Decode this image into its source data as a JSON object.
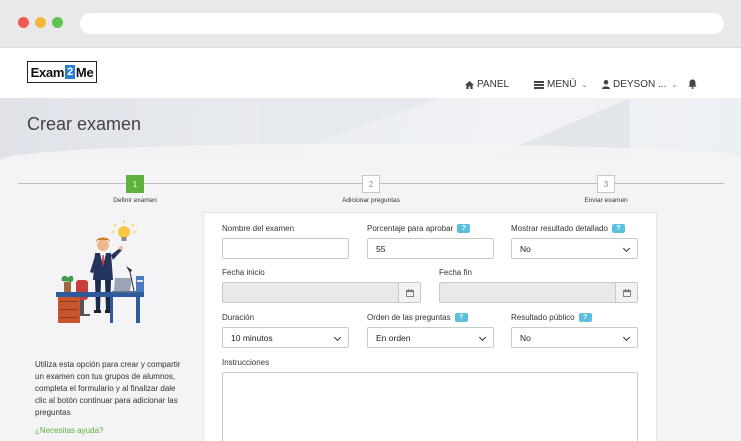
{
  "navbar": {
    "logo_left": "Exam",
    "logo_mid": "2",
    "logo_right": "Me",
    "panel": "PANEL",
    "menu": "MENÚ",
    "user": "DEYSON ..."
  },
  "page": {
    "title": "Crear examen"
  },
  "steps": [
    {
      "number": "1",
      "label": "Definir examen",
      "active": true
    },
    {
      "number": "2",
      "label": "Adicionar preguntas",
      "active": false
    },
    {
      "number": "3",
      "label": "Enviar examen",
      "active": false
    }
  ],
  "sidebar": {
    "description": "Utiliza esta opción para crear y compartir un examen con tus grupos de alumnos, completa el formulario y al finalizar dale clic al botón continuar para adicionar las preguntas",
    "help_link": "¿Necesitas ayuda?"
  },
  "form": {
    "exam_name": {
      "label": "Nombre del examen",
      "value": ""
    },
    "pass_percent": {
      "label": "Porcentaje para aprobar",
      "value": "55"
    },
    "show_result": {
      "label": "Mostrar resultado detallado",
      "value": "No"
    },
    "start_date": {
      "label": "Fecha inicio",
      "value": ""
    },
    "end_date": {
      "label": "Fecha fin",
      "value": ""
    },
    "duration": {
      "label": "Duración",
      "value": "10 minutos"
    },
    "question_order": {
      "label": "Orden de las preguntas",
      "value": "En orden"
    },
    "public_result": {
      "label": "Resultado público",
      "value": "No"
    },
    "instructions": {
      "label": "Instrucciones",
      "value": ""
    },
    "help_badge": "?"
  },
  "colors": {
    "accent_green": "#5fb13b",
    "info_badge": "#5bc0de",
    "logo_blue": "#2a7fd4"
  },
  "icons": [
    "home-icon",
    "menu-icon",
    "user-icon",
    "bell-icon",
    "calendar-icon",
    "chevron-down-icon",
    "question-icon"
  ]
}
